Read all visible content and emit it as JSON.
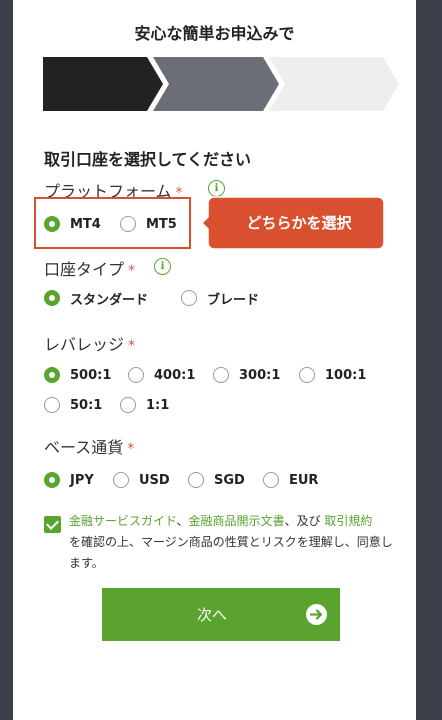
{
  "header": {
    "title": "安心な簡単お申込みで"
  },
  "form": {
    "section_title": "取引口座を選択してください",
    "platform": {
      "label": "プラットフォーム",
      "required_mark": "*",
      "options": [
        "MT4",
        "MT5"
      ],
      "selected": "MT4"
    },
    "account_type": {
      "label": "口座タイプ",
      "required_mark": "*",
      "options": [
        "スタンダード",
        "ブレード"
      ],
      "selected": "スタンダード"
    },
    "leverage": {
      "label": "レバレッジ",
      "required_mark": "*",
      "options": [
        "500:1",
        "400:1",
        "300:1",
        "100:1",
        "50:1",
        "1:1"
      ],
      "selected": "500:1"
    },
    "base_currency": {
      "label": "ベース通貨",
      "required_mark": "*",
      "options": [
        "JPY",
        "USD",
        "SGD",
        "EUR"
      ],
      "selected": "JPY"
    },
    "agreement": {
      "link1": "金融サービスガイド",
      "sep1": "、",
      "link2": "金融商品開示文書",
      "sep2": "、及び ",
      "link3": "取引規約",
      "text": "を確認の上、マージン商品の性質とリスクを理解し、同意します。"
    },
    "next_button": "次へ"
  },
  "annotation": {
    "callout": "どちらかを選択"
  },
  "colors": {
    "accent": "#5aa32e",
    "annotation": "#d8502f",
    "step_done": "#222222",
    "step_current": "#6b6e76",
    "step_todo": "#eeeeee"
  }
}
